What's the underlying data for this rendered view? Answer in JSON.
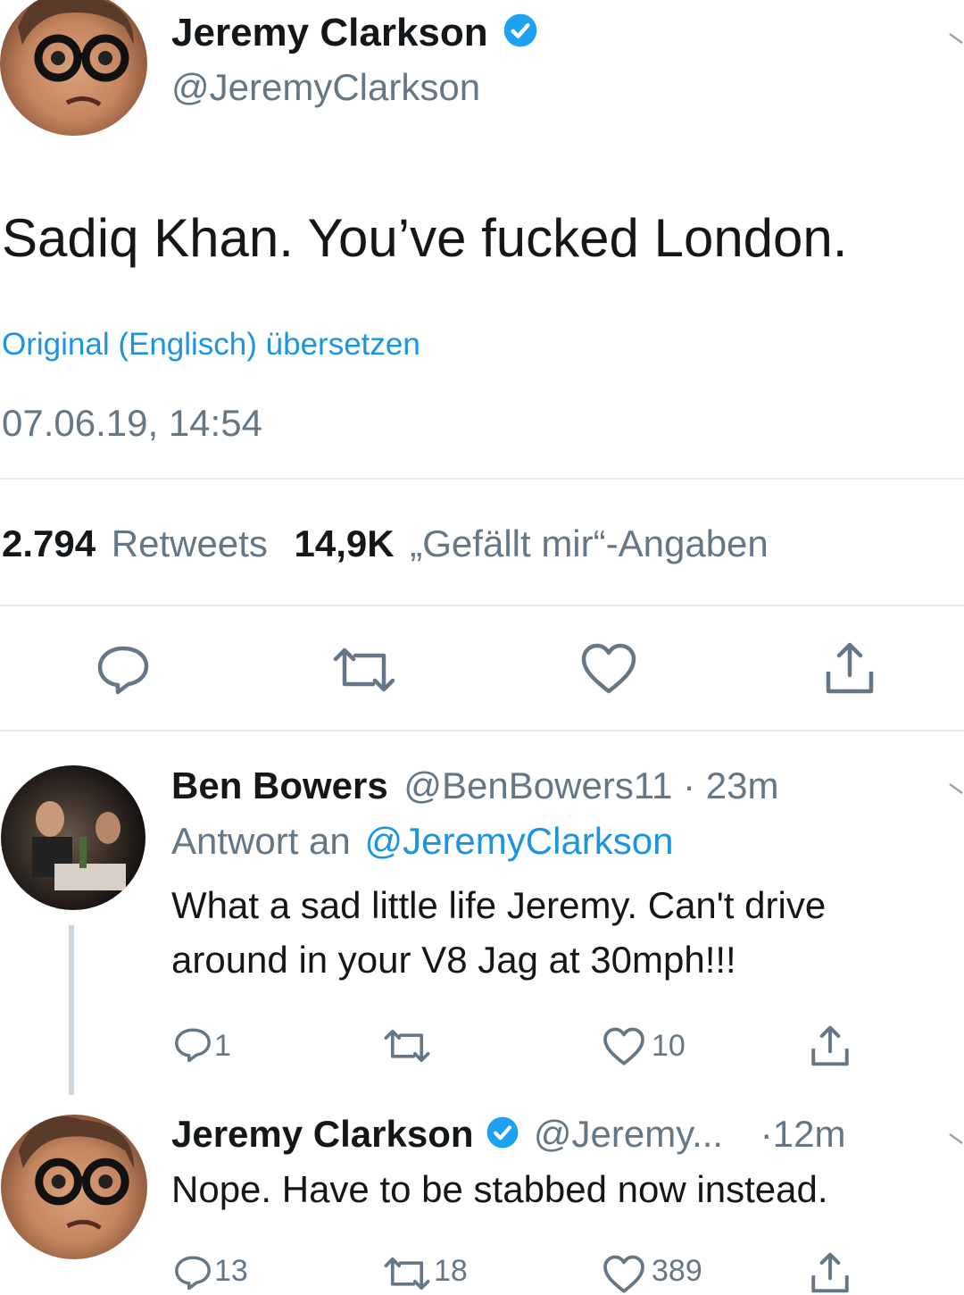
{
  "main_tweet": {
    "author_name": "Jeremy Clarkson",
    "author_handle": "@JeremyClarkson",
    "text": "Sadiq Khan. You’ve fucked London.",
    "translate_label": "Original (Englisch) übersetzen",
    "timestamp": "07.06.19, 14:54",
    "retweet_count": "2.794",
    "retweet_label": "Retweets",
    "like_count": "14,9K",
    "like_label": "„Gefällt mir“-Angaben"
  },
  "reply1": {
    "author_name": "Ben Bowers",
    "author_handle": "@BenBowers11",
    "time": "· 23m",
    "reply_to_prefix": "Antwort an",
    "reply_to_handle": "@JeremyClarkson",
    "text_line1": "What a sad little life Jeremy. Can't drive",
    "text_line2": "around in your V8 Jag at 30mph!!!",
    "reply_count": "1",
    "like_count": "10"
  },
  "reply2": {
    "author_name": "Jeremy Clarkson",
    "author_handle": "@Jeremy...",
    "time": "·12m",
    "text": "Nope. Have to be stabbed now instead.",
    "reply_count": "13",
    "retweet_count": "18",
    "like_count": "389"
  },
  "colors": {
    "link": "#1b95e0",
    "muted": "#657786",
    "verified": "#1da1f2",
    "divider": "#e6ecf0"
  },
  "icons": [
    "verified-badge-icon",
    "chevron-down-icon",
    "reply-icon",
    "retweet-icon",
    "like-icon",
    "share-icon"
  ]
}
